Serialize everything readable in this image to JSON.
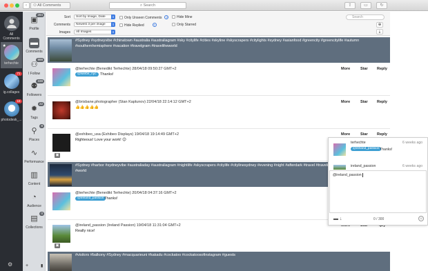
{
  "window": {
    "breadcrumb": "All Comments",
    "search_placeholder": "Search"
  },
  "accounts": [
    {
      "label": "All Comments"
    },
    {
      "label": "terhechte"
    },
    {
      "label": "ig.collages",
      "badge": "71"
    },
    {
      "label": "photodesk_...",
      "badge": "18"
    }
  ],
  "nav": [
    {
      "label": "Profile",
      "count": "284",
      "icon": "image-icon"
    },
    {
      "label": "Comments",
      "count": "",
      "icon": "chat-bubble-icon"
    },
    {
      "label": "I Follow",
      "count": "999",
      "icon": "people-icon"
    },
    {
      "label": "Followers",
      "count": "339",
      "icon": "followers-icon"
    },
    {
      "label": "Tags",
      "count": "22",
      "icon": "gear-tags-icon"
    },
    {
      "label": "Places",
      "count": "8",
      "icon": "pin-icon"
    },
    {
      "label": "Performance",
      "count": "",
      "icon": "pulse-icon"
    },
    {
      "label": "Content",
      "count": "",
      "icon": "bar-chart-icon"
    },
    {
      "label": "Audience",
      "count": "",
      "icon": "gauge-icon"
    },
    {
      "label": "Collections",
      "count": "0",
      "icon": "collections-icon"
    }
  ],
  "filters": {
    "sort_label": "Sort",
    "sort_value": "Sort by Image, Date",
    "comments_label": "Comments",
    "comments_value": "Newest 3 per image",
    "images_label": "Images",
    "images_value": "All Images",
    "only_unseen": "Only Unseen Comments",
    "hide_replied": "Hide Replied",
    "hide_mine": "Hide Mine",
    "only_starred": "Only Starred",
    "search_placeholder": "Search"
  },
  "actions": {
    "more": "More",
    "star": "Star",
    "reply": "Reply",
    "reply_partial": ".ply"
  },
  "posts": [
    {
      "caption": "#Sydney #sydneyvibe #chinatown #australia #australiagram #sky #citylife #cities #skyline #skyscrapers #citylights #sydney #asianfood #greencity #greencitylife #autumn #southernhemisphere #vacation #travelgram #traveltheworld",
      "comments": [
        {
          "header": "@terhechte (Benedikt Terhechte) 28/04/18 09:50:27 GMT+2",
          "mention": "@wiebe_nyc",
          "text": "Thanks!"
        },
        {
          "header": "@brisbane.photographer (Stan Kaplunov) 22/04/18 22:14:12 GMT+2",
          "mention": "",
          "text": "👍👍👍👍👍"
        },
        {
          "header": "@exhibeo_usa (Exhibeo Displays) 19/04/18 19:14:49 GMT+2",
          "mention": "",
          "text": "Righteous! Love your work! 😉"
        }
      ]
    },
    {
      "caption": "#Sydney #harbor #sydneyvibe #australiaday #australiagram #nightlife #skyscrapers #citylife #citylinesydney #evening #night #afterdark #travel #travelingram #colored #sky #sea #cities #world",
      "comments": [
        {
          "header": "@terhechte (Benedikt Terhechte) 20/04/18 04:37:16 GMT+2",
          "mention": "@ireland_passion",
          "text": "Thanks!"
        },
        {
          "header": "@ireland_passion (Ireland Passion) 19/04/18 11:31:04 GMT+2",
          "mention": "",
          "text": "Really nice!"
        }
      ]
    },
    {
      "caption": "#visitors #balkony #Sydney #macquarieuni #kakadu #cockatoo #cockatoosofinstagram #guests",
      "comments": []
    }
  ],
  "reply_panel": {
    "rows": [
      {
        "user": "terhechte",
        "mention": "@ireland_passion",
        "text": "Thanks!",
        "time": "6 weeks ago"
      },
      {
        "user": "ireland_passion",
        "mention": "",
        "text": "",
        "time": "6 weeks ago"
      }
    ],
    "draft": "@ireland_passion",
    "counter": "0 / 300"
  },
  "colors": {
    "post_band": "#5f6e7e",
    "accent": "#3d7be1",
    "mention": "#3d9fd3",
    "badge": "#e0393e",
    "account_bg": "#2a2d33",
    "nav_bg": "#dadde1"
  }
}
